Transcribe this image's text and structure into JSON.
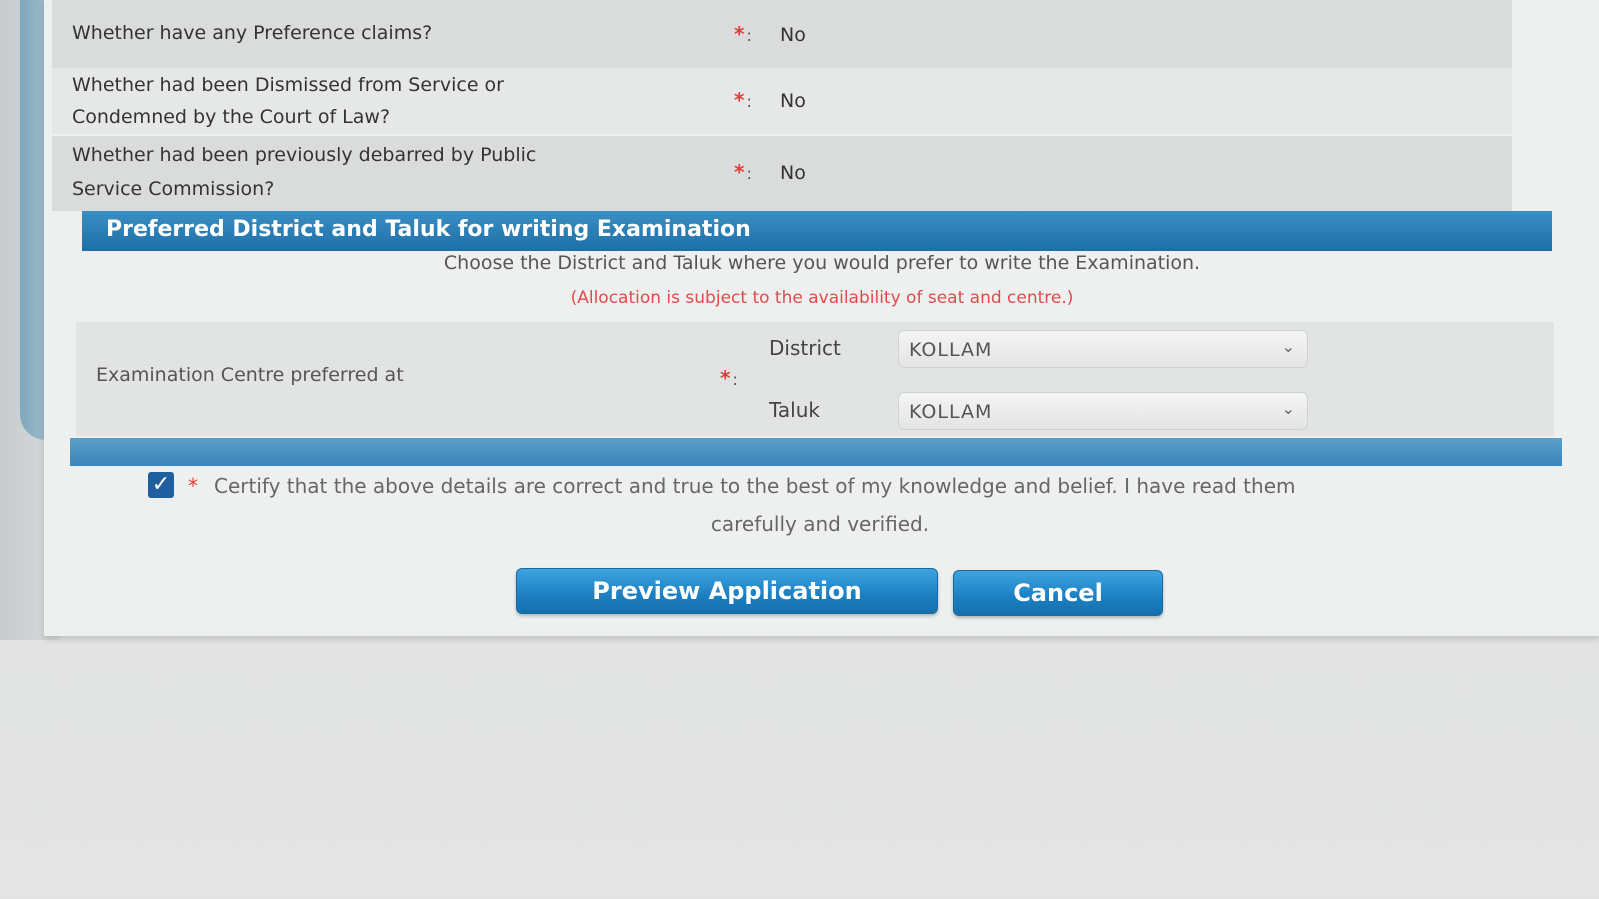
{
  "questions": [
    {
      "text_line1": "Whether have any Preference claims?",
      "text_line2": "",
      "answer": "No"
    },
    {
      "text_line1": "Whether had been Dismissed from Service or",
      "text_line2": "Condemned by the Court of Law?",
      "answer": "No"
    },
    {
      "text_line1": "Whether had been previously debarred by Public",
      "text_line2": "Service Commission?",
      "answer": "No"
    }
  ],
  "required_marker": "*",
  "colon": ":",
  "section": {
    "title": "Preferred District and Taluk for writing Examination",
    "instruction": "Choose the District and Taluk where you would prefer to write the Examination.",
    "note": "(Allocation is subject to the availability of seat and centre.)"
  },
  "exam_centre": {
    "label": "Examination Centre preferred at",
    "district_label": "District",
    "district_value": "KOLLAM",
    "taluk_label": "Taluk",
    "taluk_value": "KOLLAM"
  },
  "certify": {
    "checked": true,
    "line1": "Certify that the above details are correct and true to the best of my knowledge and belief. I have read them",
    "line2": "carefully and verified."
  },
  "buttons": {
    "preview": "Preview Application",
    "cancel": "Cancel"
  },
  "colors": {
    "section_bar": "#1e6fa6",
    "button": "#1b7fc2",
    "required": "#e33b3b"
  }
}
